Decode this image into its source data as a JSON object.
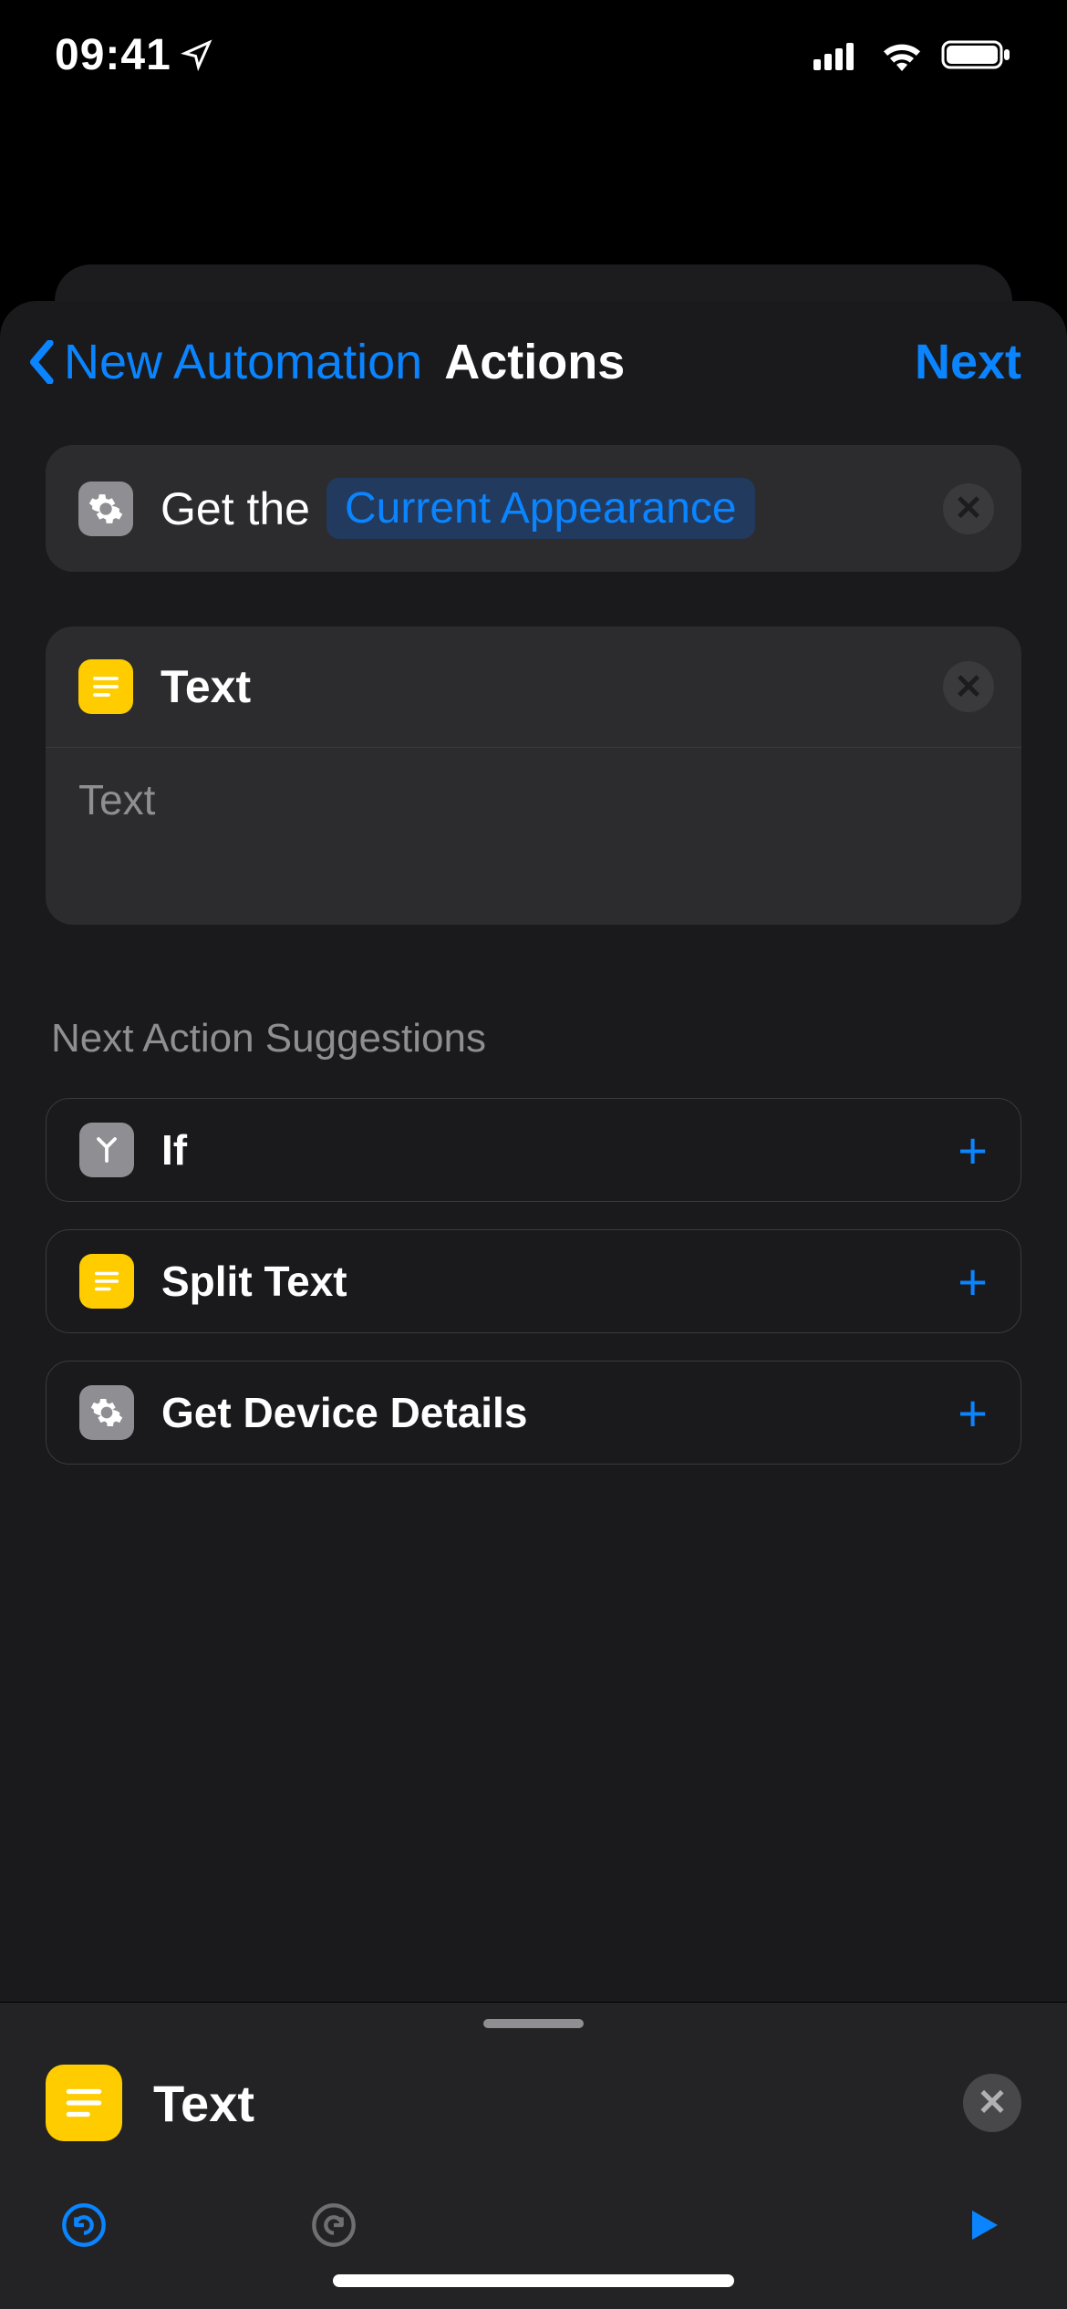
{
  "status": {
    "time": "09:41"
  },
  "nav": {
    "back": "New Automation",
    "title": "Actions",
    "next": "Next"
  },
  "actions": [
    {
      "icon": "gear",
      "prefix": "Get the",
      "param": "Current Appearance"
    },
    {
      "icon": "text",
      "title": "Text",
      "placeholder": "Text"
    }
  ],
  "suggestions_header": "Next Action Suggestions",
  "suggestions": [
    {
      "icon": "branch",
      "label": "If"
    },
    {
      "icon": "text",
      "label": "Split Text"
    },
    {
      "icon": "gear",
      "label": "Get Device Details"
    }
  ],
  "bottom": {
    "title": "Text"
  }
}
